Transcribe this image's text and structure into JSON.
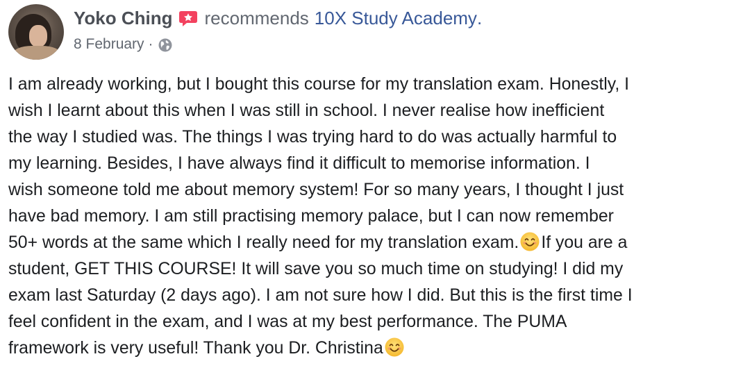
{
  "post": {
    "author": "Yoko Ching",
    "verb": "recommends",
    "page_name": "10X Study Academy",
    "trail": ".",
    "date": "8 February",
    "separator": "·",
    "icons": {
      "recommend": "recommend-star-icon",
      "audience": "globe-icon",
      "emoji": "smiling-face-emoji"
    },
    "colors": {
      "link": "#385898",
      "secondary_text": "#616770",
      "author": "#4b4f56",
      "recommend_badge": "#f3425f"
    },
    "body": {
      "l1": "I am already working, but I bought this course for my translation exam. Honestly, I",
      "l2": "wish I learnt about this when I was still in school. I never realise how inefficient",
      "l3": "the way I studied was. The things I was trying hard to do was actually harmful to",
      "l4": "my learning. Besides, I have always find it difficult to memorise information. I",
      "l5": "wish someone told me about memory system! For so many years, I thought I just",
      "l6": "have bad memory. I am still practising memory palace, but I can now remember",
      "l7a": "50+ words at the same which I really need for my translation exam.",
      "l7b": "If you are a",
      "l8": "student, GET THIS COURSE! It will save you so much time on studying! I did my",
      "l9": "exam last Saturday (2 days ago). I am not sure how I did. But this is the first time I",
      "l10": "feel confident in the exam, and I was at my best performance. The PUMA",
      "l11": "framework is very useful! Thank you Dr. Christina"
    }
  }
}
